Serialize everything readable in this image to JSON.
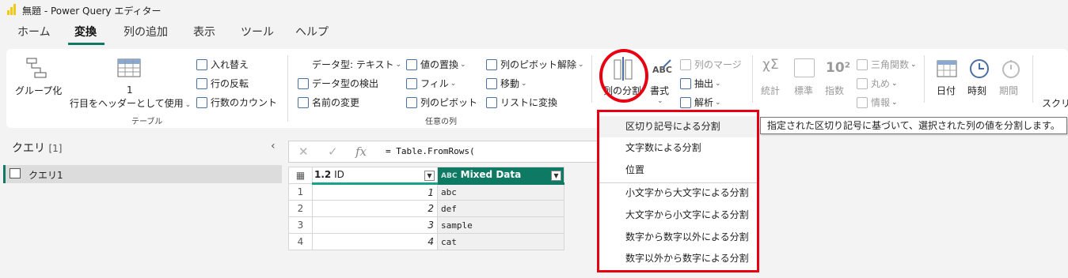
{
  "window": {
    "title": "無題 - Power Query エディター"
  },
  "menu": {
    "tabs": [
      "ホーム",
      "変換",
      "列の追加",
      "表示",
      "ツール",
      "ヘルプ"
    ],
    "active": "変換"
  },
  "ribbon": {
    "table_group": {
      "label": "テーブル",
      "group_by": "グループ化",
      "use_first_row": {
        "number": "1",
        "label": "行目をヘッダーとして使用"
      },
      "transpose": "入れ替え",
      "reverse_rows": "行の反転",
      "count_rows": "行数のカウント"
    },
    "any_column_group": {
      "label": "任意の列",
      "data_type": "データ型: テキスト",
      "detect_type": "データ型の検出",
      "rename": "名前の変更",
      "replace_values": "値の置換",
      "fill": "フィル",
      "pivot": "列のピボット",
      "unpivot": "列のピボット解除",
      "move": "移動",
      "to_list": "リストに変換"
    },
    "text_group": {
      "split_column": "列の分割",
      "format": "書式",
      "merge_columns": "列のマージ",
      "extract": "抽出",
      "parse": "解析"
    },
    "number_group": {
      "statistics": "統計",
      "standard": "標準",
      "scientific": "指数",
      "trig": "三角関数",
      "rounding": "丸め",
      "information": "情報"
    },
    "datetime_group": {
      "date": "日付",
      "time": "時刻",
      "duration": "期間"
    },
    "script": "スクリ"
  },
  "queries": {
    "title": "クエリ",
    "count": "[1]",
    "items": [
      "クエリ1"
    ]
  },
  "formula": {
    "cancel": "✕",
    "confirm": "✓",
    "fx": "fx",
    "text": "= Table.FromRows("
  },
  "grid": {
    "columns": [
      {
        "type": "1.2",
        "name": "ID"
      },
      {
        "type": "ABC",
        "name": "Mixed Data"
      }
    ],
    "rows": [
      {
        "n": "1",
        "id": "1",
        "mixed": "abc"
      },
      {
        "n": "2",
        "id": "2",
        "mixed": "def"
      },
      {
        "n": "3",
        "id": "3",
        "mixed": "sample"
      },
      {
        "n": "4",
        "id": "4",
        "mixed": "cat"
      }
    ]
  },
  "dropdown": {
    "items": [
      "区切り記号による分割",
      "文字数による分割",
      "位置",
      "小文字から大文字による分割",
      "大文字から小文字による分割",
      "数字から数字以外による分割",
      "数字以外から数字による分割"
    ]
  },
  "tooltip": {
    "text": "指定された区切り記号に基づいて、選択された列の値を分割します。"
  },
  "colors": {
    "accent": "#117865",
    "highlight": "#e60012",
    "header_bg": "#0e7a64"
  }
}
